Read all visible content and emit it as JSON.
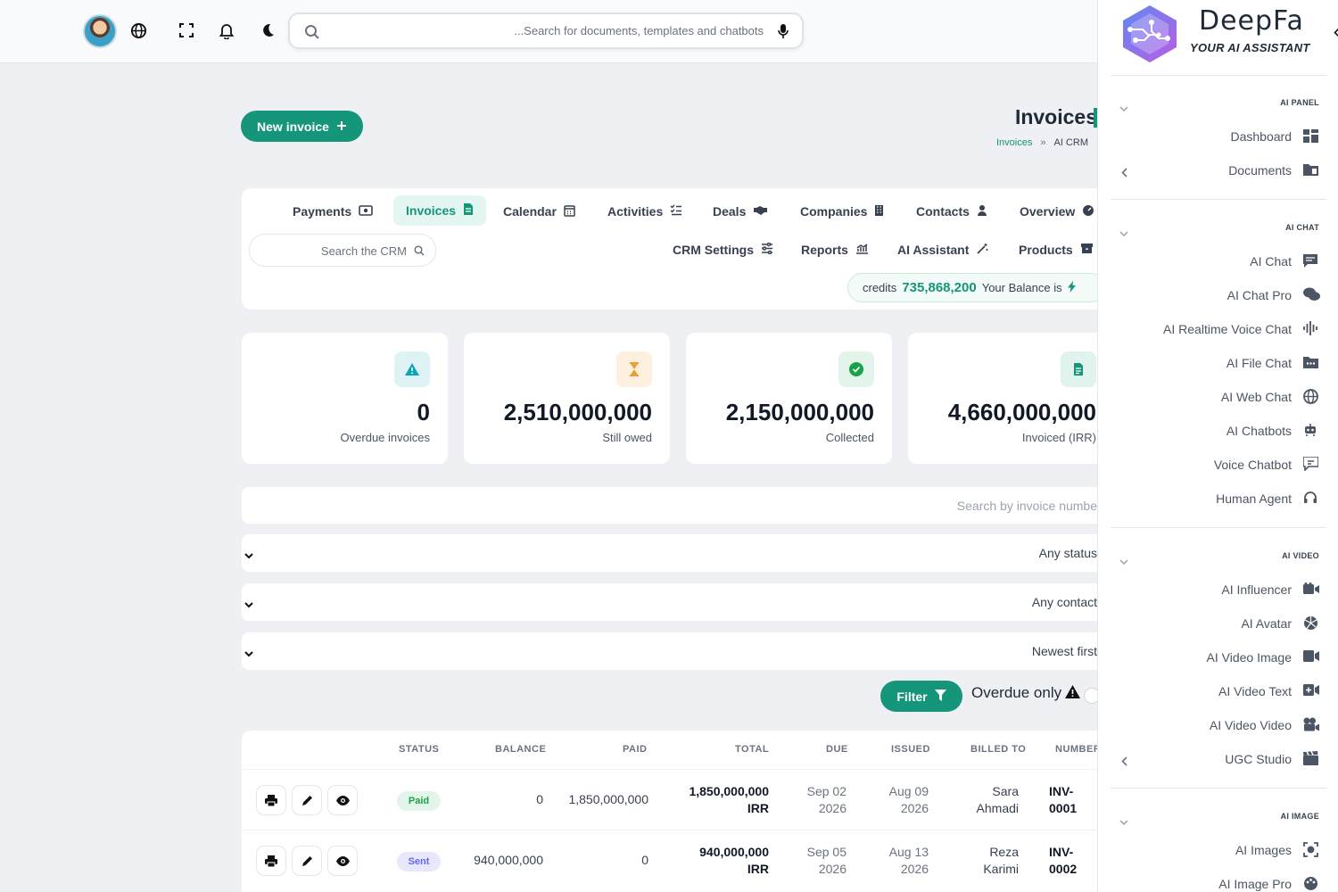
{
  "topbar": {
    "search_placeholder": "...Search for documents, templates and chatbots"
  },
  "header": {
    "new_invoice_label": "New invoice",
    "title": "Invoices",
    "breadcrumb": [
      "Invoices",
      "»",
      "AI CRM"
    ]
  },
  "crm_nav": {
    "row1": [
      "Payments",
      "Invoices",
      "Calendar",
      "Activities",
      "Deals",
      "Companies",
      "Contacts",
      "Overview"
    ],
    "row2": [
      "CRM Settings",
      "Reports",
      "AI Assistant",
      "Products"
    ],
    "active": "Invoices",
    "search_placeholder": "Search the CRM",
    "credits_label": "credits",
    "credits_value": "735,868,200",
    "balance_label": "Your Balance is"
  },
  "stats": [
    {
      "value": "0",
      "label": "Overdue invoices",
      "icon": "warning-icon",
      "color": "#0ea5b7"
    },
    {
      "value": "2,510,000,000",
      "label": "Still owed",
      "icon": "hourglass-icon",
      "color": "#e5a13c"
    },
    {
      "value": "2,150,000,000",
      "label": "Collected",
      "icon": "check-circle-icon",
      "color": "#16a34a"
    },
    {
      "value": "4,660,000,000",
      "label": "Invoiced (IRR)",
      "icon": "document-icon",
      "color": "#15957a"
    }
  ],
  "filters": {
    "invoice_search_placeholder": "Search by invoice numbe",
    "status_select": "Any status",
    "contact_select": "Any contact",
    "sort_select": "Newest first",
    "filter_button": "Filter",
    "overdue_only_label": "Overdue only"
  },
  "table": {
    "headers": [
      "STATUS",
      "BALANCE",
      "PAID",
      "TOTAL",
      "DUE",
      "ISSUED",
      "BILLED TO",
      "NUMBER"
    ],
    "rows": [
      {
        "status": "Paid",
        "balance": "0",
        "paid": "1,850,000,000",
        "total_amount": "1,850,000,000",
        "total_currency": "IRR",
        "due_md": "Sep 02",
        "due_y": "2026",
        "issued_md": "Aug 09",
        "issued_y": "2026",
        "billed_first": "Sara",
        "billed_last": "Ahmadi",
        "num_a": "INV-",
        "num_b": "0001"
      },
      {
        "status": "Sent",
        "balance": "940,000,000",
        "paid": "0",
        "total_amount": "940,000,000",
        "total_currency": "IRR",
        "due_md": "Sep 05",
        "due_y": "2026",
        "issued_md": "Aug 13",
        "issued_y": "2026",
        "billed_first": "Reza",
        "billed_last": "Karimi",
        "num_a": "INV-",
        "num_b": "0002"
      }
    ]
  },
  "sidebar": {
    "brand": "DeepFa",
    "tagline": "YOUR AI ASSISTANT",
    "sections": [
      {
        "title": "AI PANEL",
        "items": [
          "Dashboard",
          "Documents"
        ]
      },
      {
        "title": "AI CHAT",
        "items": [
          "AI Chat",
          "AI Chat Pro",
          "AI Realtime Voice Chat",
          "AI File Chat",
          "AI Web Chat",
          "AI Chatbots",
          "Voice Chatbot",
          "Human Agent"
        ]
      },
      {
        "title": "AI VIDEO",
        "items": [
          "AI Influencer",
          "AI Avatar",
          "AI Video Image",
          "AI Video Text",
          "AI Video Video",
          "UGC Studio"
        ]
      },
      {
        "title": "AI IMAGE",
        "items": [
          "AI Images",
          "AI Image Pro"
        ]
      }
    ]
  },
  "colors": {
    "accent": "#15957a",
    "paid": "#16a34a",
    "sent": "#6366f1"
  }
}
